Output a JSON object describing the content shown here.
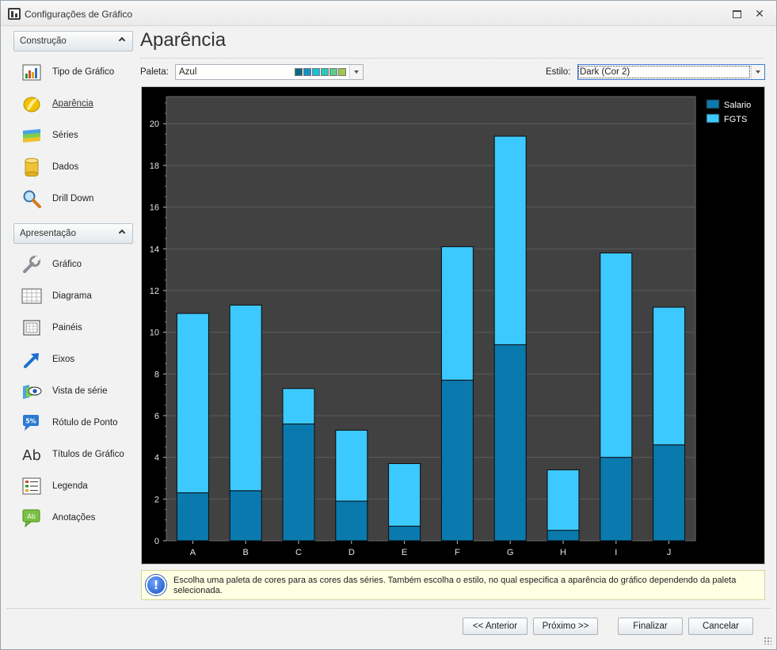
{
  "window": {
    "title": "Configurações de Gráfico",
    "restore_icon": "restore-icon",
    "close_icon": "close-icon"
  },
  "nav": {
    "groups": [
      {
        "label": "Construção",
        "items": [
          {
            "label": "Tipo de Gráfico",
            "icon": "chart-type-icon"
          },
          {
            "label": "Aparência",
            "icon": "appearance-icon",
            "active": true
          },
          {
            "label": "Séries",
            "icon": "series-icon"
          },
          {
            "label": "Dados",
            "icon": "data-icon"
          },
          {
            "label": "Drill Down",
            "icon": "drill-down-icon"
          }
        ]
      },
      {
        "label": "Apresentação",
        "items": [
          {
            "label": "Gráfico",
            "icon": "wrench-icon"
          },
          {
            "label": "Diagrama",
            "icon": "diagram-icon"
          },
          {
            "label": "Painéis",
            "icon": "panels-icon"
          },
          {
            "label": "Eixos",
            "icon": "axes-icon"
          },
          {
            "label": "Vista de série",
            "icon": "series-view-icon"
          },
          {
            "label": "Rótulo de Ponto",
            "icon": "point-label-icon"
          },
          {
            "label": "Títulos de Gráfico",
            "icon": "chart-titles-icon"
          },
          {
            "label": "Legenda",
            "icon": "legend-icon"
          },
          {
            "label": "Anotações",
            "icon": "annotations-icon"
          }
        ]
      }
    ]
  },
  "page": {
    "title": "Aparência",
    "palette_label": "Paleta:",
    "palette_value": "Azul",
    "palette_swatches": [
      "#0a6b84",
      "#1491c4",
      "#1ebfd9",
      "#2cc7b8",
      "#5ec98c",
      "#9fc84c"
    ],
    "style_label": "Estilo:",
    "style_value": "Dark (Cor 2)"
  },
  "chart_data": {
    "type": "bar",
    "stacked": true,
    "categories": [
      "A",
      "B",
      "C",
      "D",
      "E",
      "F",
      "G",
      "H",
      "I",
      "J"
    ],
    "series": [
      {
        "name": "Salario",
        "color": "#0a7aae",
        "values": [
          2.3,
          2.4,
          5.6,
          1.9,
          0.7,
          7.7,
          9.4,
          0.5,
          4.0,
          4.6
        ]
      },
      {
        "name": "FGTS",
        "color": "#3cc9ff",
        "values": [
          8.6,
          8.9,
          1.7,
          3.4,
          3.0,
          6.4,
          10.0,
          2.9,
          9.8,
          6.6
        ]
      }
    ],
    "y_ticks": [
      0,
      2,
      4,
      6,
      8,
      10,
      12,
      14,
      16,
      18,
      20
    ],
    "ylim": [
      0,
      21.3
    ],
    "grid": true,
    "legend_position": "top-right",
    "background": "#000000",
    "plot_background": "#414141"
  },
  "info": {
    "icon": "info-icon",
    "text": "Escolha uma paleta de cores para as cores das séries. Também escolha o estilo, no qual especifica a aparência do gráfico dependendo da paleta selecionada."
  },
  "footer": {
    "prev_label": "<< Anterior",
    "next_label": "Próximo >>",
    "finish_label": "Finalizar",
    "cancel_label": "Cancelar"
  }
}
